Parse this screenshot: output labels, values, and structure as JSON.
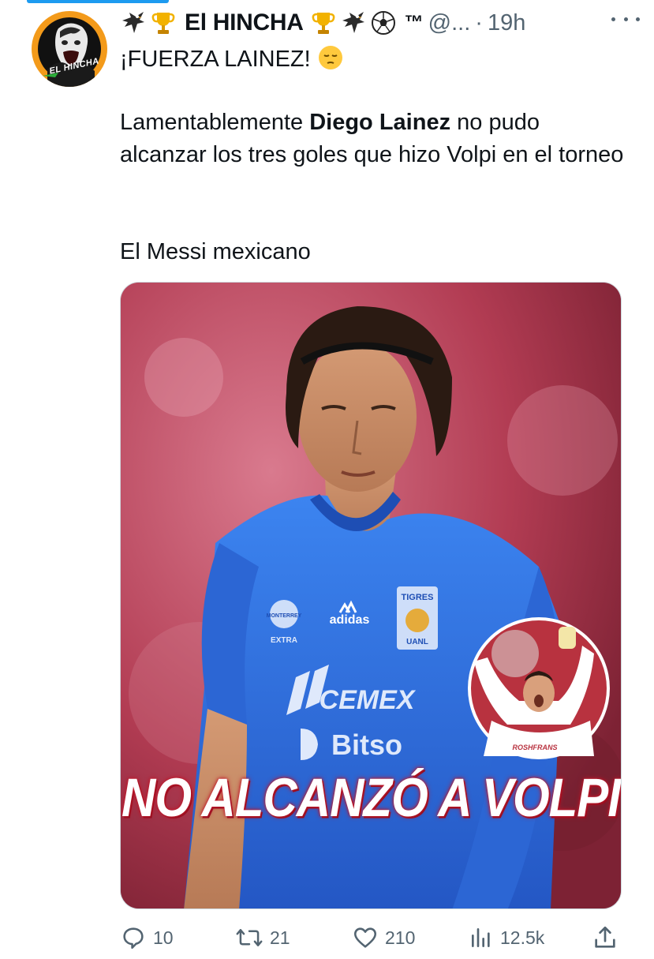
{
  "account": {
    "display_name": "El HINCHA",
    "emoji_left": [
      "eagle-emoji",
      "trophy-emoji"
    ],
    "emoji_right": [
      "trophy-emoji",
      "eagle-emoji",
      "soccer-ball-emoji"
    ],
    "tm": "™",
    "handle": "@...",
    "separator": "·",
    "time": "19h",
    "avatar_text": "EL HINCHA"
  },
  "tweet": {
    "line1": "¡FUERZA LAINEZ! ",
    "line1_emoji": "pensive-face-emoji",
    "para2_prefix": "Lamentablemente ",
    "para2_bold": "Diego Lainez",
    "para2_suffix": " no pudo alcanzar los tres goles que hizo Volpi en el torneo",
    "para3": "El Messi mexicano"
  },
  "media": {
    "caption": "NO ALCANZÓ A VOLPI",
    "jersey_sponsor": "CEMEX",
    "jersey_sponsor2": "Bitso",
    "jersey_brand": "adidas",
    "jersey_club": "TIGRES",
    "jersey_club_sub": "UANL",
    "jersey_badge": "MONTERREY",
    "jersey_badge_sub": "EXTRA",
    "inset_sponsor": "ROSHFRANS"
  },
  "actions": {
    "replies": "10",
    "retweets": "21",
    "likes": "210",
    "views": "12.5k"
  },
  "colors": {
    "text": "#0f1419",
    "muted": "#536471",
    "accent": "#1d9bf0",
    "caption_outline": "#c0182b",
    "jersey": "#2f6fe0"
  }
}
